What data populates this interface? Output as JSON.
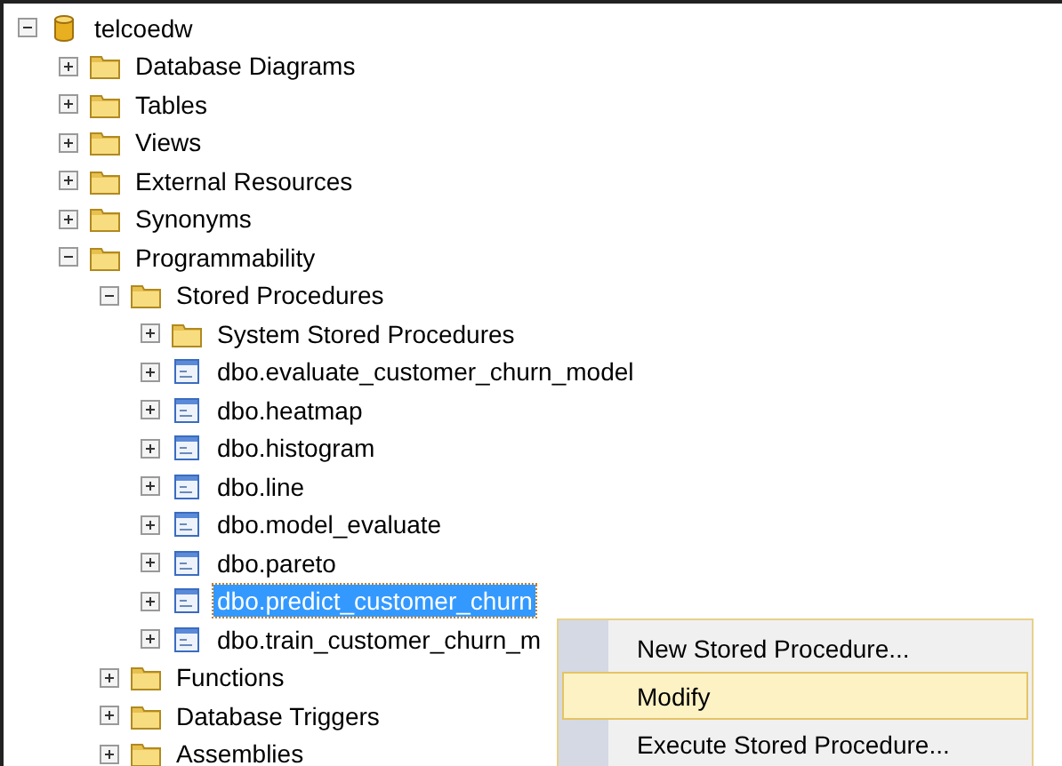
{
  "tree": [
    {
      "label": "telcoedw",
      "kind": "database",
      "expanded": true,
      "selected": false,
      "children": [
        {
          "label": "Database Diagrams",
          "kind": "folder",
          "expanded": false,
          "selected": false
        },
        {
          "label": "Tables",
          "kind": "folder",
          "expanded": false,
          "selected": false
        },
        {
          "label": "Views",
          "kind": "folder",
          "expanded": false,
          "selected": false
        },
        {
          "label": "External Resources",
          "kind": "folder",
          "expanded": false,
          "selected": false
        },
        {
          "label": "Synonyms",
          "kind": "folder",
          "expanded": false,
          "selected": false
        },
        {
          "label": "Programmability",
          "kind": "folder",
          "expanded": true,
          "selected": false,
          "children": [
            {
              "label": "Stored Procedures",
              "kind": "folder",
              "expanded": true,
              "selected": false,
              "children": [
                {
                  "label": "System Stored Procedures",
                  "kind": "folder",
                  "expanded": false,
                  "selected": false
                },
                {
                  "label": "dbo.evaluate_customer_churn_model",
                  "kind": "procedure",
                  "expanded": false,
                  "selected": false
                },
                {
                  "label": "dbo.heatmap",
                  "kind": "procedure",
                  "expanded": false,
                  "selected": false
                },
                {
                  "label": "dbo.histogram",
                  "kind": "procedure",
                  "expanded": false,
                  "selected": false
                },
                {
                  "label": "dbo.line",
                  "kind": "procedure",
                  "expanded": false,
                  "selected": false
                },
                {
                  "label": "dbo.model_evaluate",
                  "kind": "procedure",
                  "expanded": false,
                  "selected": false
                },
                {
                  "label": "dbo.pareto",
                  "kind": "procedure",
                  "expanded": false,
                  "selected": false
                },
                {
                  "label": "dbo.predict_customer_churn",
                  "kind": "procedure",
                  "expanded": false,
                  "selected": true
                },
                {
                  "label": "dbo.train_customer_churn_m",
                  "kind": "procedure",
                  "expanded": false,
                  "selected": false
                }
              ]
            },
            {
              "label": "Functions",
              "kind": "folder",
              "expanded": false,
              "selected": false
            },
            {
              "label": "Database Triggers",
              "kind": "folder",
              "expanded": false,
              "selected": false
            },
            {
              "label": "Assemblies",
              "kind": "folder",
              "expanded": false,
              "selected": false
            }
          ]
        }
      ]
    }
  ],
  "context_menu": {
    "items": [
      {
        "label": "New Stored Procedure...",
        "selected": false
      },
      {
        "label": "Modify",
        "selected": true
      },
      {
        "label": "Execute Stored Procedure...",
        "selected": false
      }
    ]
  }
}
